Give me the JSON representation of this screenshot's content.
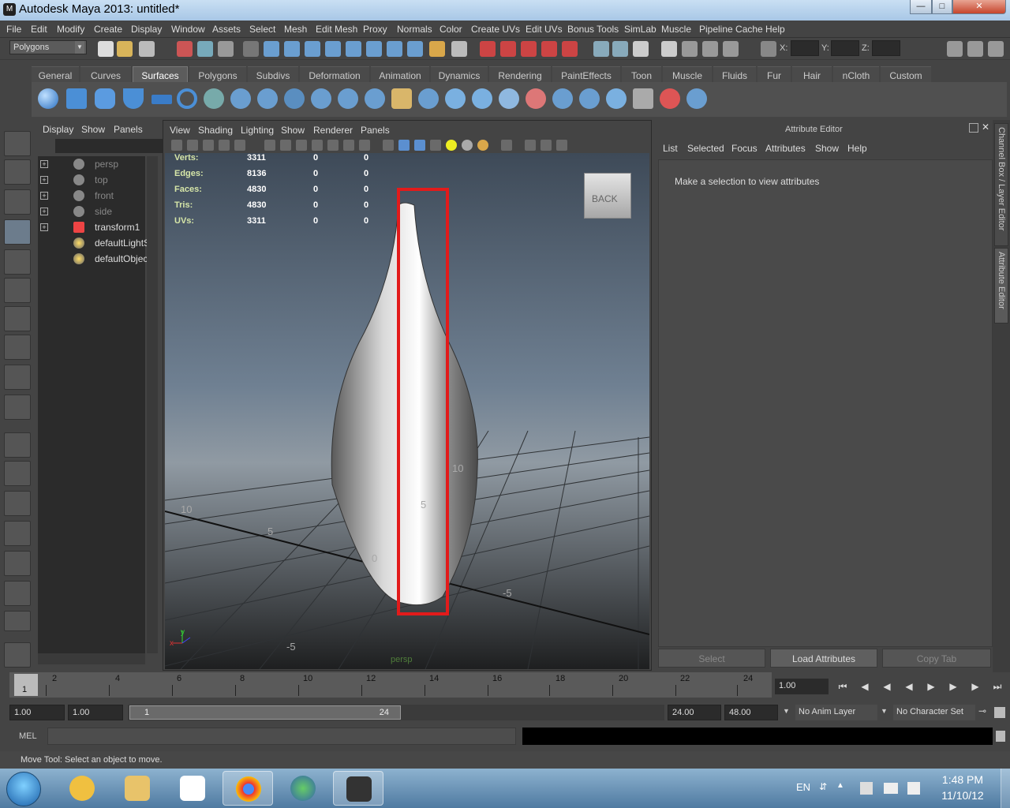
{
  "window": {
    "title": "Autodesk Maya 2013: untitled*"
  },
  "menubar": [
    "File",
    "Edit",
    "Modify",
    "Create",
    "Display",
    "Window",
    "Assets",
    "Select",
    "Mesh",
    "Edit Mesh",
    "Proxy",
    "Normals",
    "Color",
    "Create UVs",
    "Edit UVs",
    "Bonus Tools",
    "SimLab",
    "Muscle",
    "Pipeline Cache",
    "Help"
  ],
  "statusline": {
    "mode": "Polygons",
    "x_label": "X:",
    "y_label": "Y:",
    "z_label": "Z:"
  },
  "shelf": {
    "tabs": [
      "General",
      "Curves",
      "Surfaces",
      "Polygons",
      "Subdivs",
      "Deformation",
      "Animation",
      "Dynamics",
      "Rendering",
      "PaintEffects",
      "Toon",
      "Muscle",
      "Fluids",
      "Fur",
      "Hair",
      "nCloth",
      "Custom"
    ],
    "active_tab": "Surfaces"
  },
  "outliner": {
    "menu": [
      "Display",
      "Show",
      "Panels"
    ],
    "items": [
      {
        "label": "persp",
        "dim": true
      },
      {
        "label": "top",
        "dim": true
      },
      {
        "label": "front",
        "dim": true
      },
      {
        "label": "side",
        "dim": true
      },
      {
        "label": "transform1",
        "dim": false
      },
      {
        "label": "defaultLightS",
        "dim": false
      },
      {
        "label": "defaultObjec",
        "dim": false
      }
    ]
  },
  "viewport": {
    "menu": [
      "View",
      "Shading",
      "Lighting",
      "Show",
      "Renderer",
      "Panels"
    ],
    "hud": {
      "labels": [
        "Verts:",
        "Edges:",
        "Faces:",
        "Tris:",
        "UVs:"
      ],
      "col1": [
        "3311",
        "8136",
        "4830",
        "4830",
        "3311"
      ],
      "col2": [
        "0",
        "0",
        "0",
        "0",
        "0"
      ],
      "col3": [
        "0",
        "0",
        "0",
        "0",
        "0"
      ]
    },
    "viewcube_label": "BACK",
    "grid_labels": [
      "10",
      "5",
      "0",
      "10",
      "5",
      "-5",
      "-5"
    ],
    "camera_label": "persp",
    "axis_x": "x",
    "axis_y": "y"
  },
  "attribute_editor": {
    "title": "Attribute Editor",
    "menu": [
      "List",
      "Selected",
      "Focus",
      "Attributes",
      "Show",
      "Help"
    ],
    "message": "Make a selection to view attributes",
    "buttons": [
      "Select",
      "Load Attributes",
      "Copy Tab"
    ]
  },
  "side_tabs": [
    "Channel Box / Layer Editor",
    "Attribute Editor"
  ],
  "timeline": {
    "ticks": [
      "2",
      "4",
      "6",
      "8",
      "10",
      "12",
      "14",
      "16",
      "18",
      "20",
      "22",
      "24"
    ],
    "current_frame_marker": "1",
    "current_frame": "1.00"
  },
  "range": {
    "start": "1.00",
    "playback_start": "1.00",
    "slider_start": "1",
    "slider_end": "24",
    "playback_end": "24.00",
    "end": "48.00",
    "anim_layer": "No Anim Layer",
    "character_set": "No Character Set"
  },
  "cmdline": {
    "label": "MEL"
  },
  "helpline": {
    "text": "Move Tool: Select an object to move."
  },
  "taskbar": {
    "lang": "EN",
    "time": "1:48 PM",
    "date": "11/10/12"
  }
}
